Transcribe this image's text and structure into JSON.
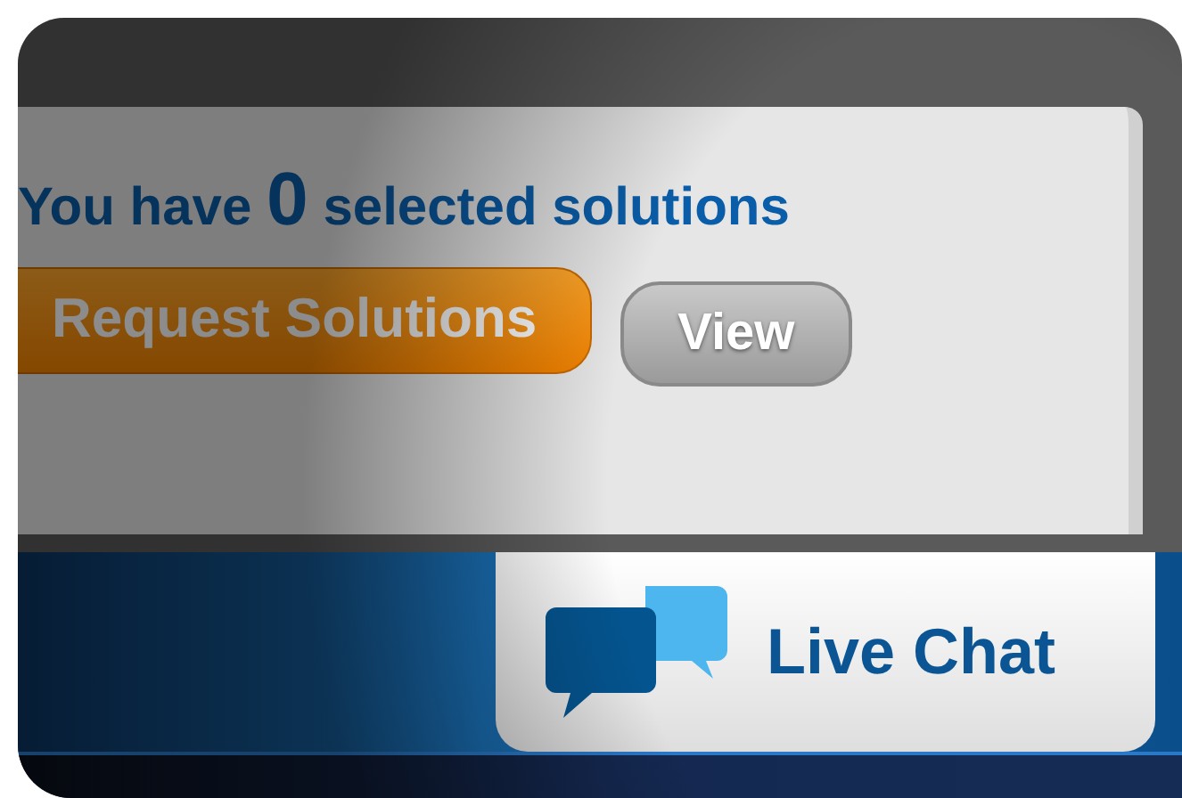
{
  "selection_summary": {
    "prefix": "You have",
    "count": "0",
    "suffix": "selected solutions"
  },
  "buttons": [
    {
      "label": "Request Solutions",
      "kind": "primary"
    },
    {
      "label": "View",
      "kind": "secondary"
    }
  ],
  "live_chat_tab": {
    "label": "Live Chat",
    "selected": true
  }
}
